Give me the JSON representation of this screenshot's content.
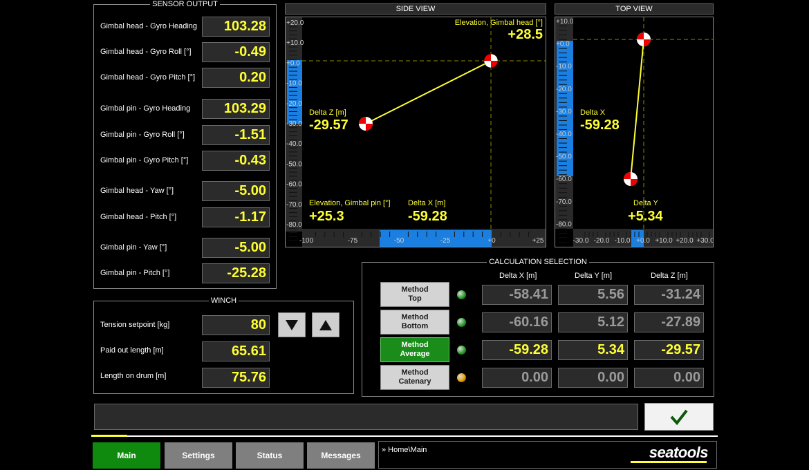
{
  "sensor_output": {
    "title": "SENSOR OUTPUT",
    "rows": [
      {
        "label": "Gimbal head - Gyro Heading",
        "value": "103.28"
      },
      {
        "label": "Gimbal head - Gyro Roll [°]",
        "value": "-0.49"
      },
      {
        "label": "Gimbal head - Gyro Pitch [°]",
        "value": "0.20"
      },
      {
        "label": "Gimbal pin - Gyro Heading",
        "value": "103.29"
      },
      {
        "label": "Gimbal pin - Gyro Roll [°]",
        "value": "-1.51"
      },
      {
        "label": "Gimbal pin - Gyro Pitch [°]",
        "value": "-0.43"
      },
      {
        "label": "Gimbal head - Yaw [°]",
        "value": "-5.00"
      },
      {
        "label": "Gimbal head - Pitch [°]",
        "value": "-1.17"
      },
      {
        "label": "Gimbal pin - Yaw [°]",
        "value": "-5.00"
      },
      {
        "label": "Gimbal pin - Pitch [°]",
        "value": "-25.28"
      }
    ]
  },
  "side_view": {
    "title": "SIDE VIEW",
    "y_ticks": [
      "+20.0",
      "+10.0",
      "+0.0",
      "-10.0",
      "-20.0",
      "-30.0",
      "-40.0",
      "-50.0",
      "-60.0",
      "-70.0",
      "-80.0"
    ],
    "x_ticks": [
      "-100",
      "-75",
      "-50",
      "-25",
      "+0",
      "+25"
    ],
    "elev_head_label": "Elevation, Gimbal head [°]",
    "elev_head_value": "+28.5",
    "delta_z_label": "Delta Z [m]",
    "delta_z_value": "-29.57",
    "elev_pin_label": "Elevation, Gimbal pin [°]",
    "elev_pin_value": "+25.3",
    "delta_x_label": "Delta X [m]",
    "delta_x_value": "-59.28"
  },
  "top_view": {
    "title": "TOP VIEW",
    "y_ticks": [
      "+10.0",
      "+0.0",
      "-10.0",
      "-20.0",
      "-30.0",
      "-40.0",
      "-50.0",
      "-60.0",
      "-70.0",
      "-80.0"
    ],
    "x_ticks": [
      "-30.0",
      "-20.0",
      "-10.0",
      "+0.0",
      "+10.0",
      "+20.0",
      "+30.0"
    ],
    "delta_x_label": "Delta X",
    "delta_x_value": "-59.28",
    "delta_y_label": "Delta Y",
    "delta_y_value": "+5.34"
  },
  "winch": {
    "title": "WINCH",
    "tension_label": "Tension setpoint [kg]",
    "tension_value": "80",
    "paid_label": "Paid out length [m]",
    "paid_value": "65.61",
    "drum_label": "Length on drum [m]",
    "drum_value": "75.76",
    "down_icon": "arrow-down-icon",
    "up_icon": "arrow-up-icon"
  },
  "calculation": {
    "title": "CALCULATION SELECTION",
    "headers": [
      "Delta X [m]",
      "Delta Y [m]",
      "Delta Z [m]"
    ],
    "rows": [
      {
        "line1": "Method",
        "line2": "Top",
        "dx": "-58.41",
        "dy": "5.56",
        "dz": "-31.24",
        "led": "#2aa02a",
        "active": false
      },
      {
        "line1": "Method",
        "line2": "Bottom",
        "dx": "-60.16",
        "dy": "5.12",
        "dz": "-27.89",
        "led": "#2aa02a",
        "active": false
      },
      {
        "line1": "Method",
        "line2": "Average",
        "dx": "-59.28",
        "dy": "5.34",
        "dz": "-29.57",
        "led": "#2aa02a",
        "active": true
      },
      {
        "line1": "Method",
        "line2": "Catenary",
        "dx": "0.00",
        "dy": "0.00",
        "dz": "0.00",
        "led": "#e8a000",
        "active": false
      }
    ]
  },
  "message_bar": {
    "text": "",
    "confirm_icon": "checkmark-icon"
  },
  "nav": {
    "tabs": [
      "Main",
      "Settings",
      "Status",
      "Messages"
    ],
    "active": "Main",
    "breadcrumb": "» Home\\Main",
    "logo": "seatools"
  },
  "colors": {
    "accent_yellow": "#ffff33",
    "active_green": "#0f8a0f",
    "scale_blue": "#1a7fe0"
  }
}
